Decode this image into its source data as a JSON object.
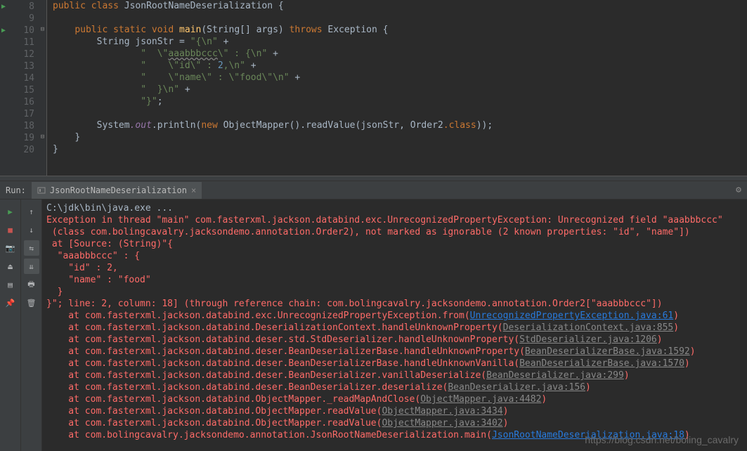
{
  "gutter_lines": [
    "8",
    "9",
    "10",
    "11",
    "12",
    "13",
    "14",
    "15",
    "16",
    "17",
    "18",
    "19",
    "20"
  ],
  "code": {
    "l8": {
      "kw1": "public",
      "kw2": "class",
      "cls": "JsonRootNameDeserialization",
      "brace": "{"
    },
    "l10": {
      "kw1": "public",
      "kw2": "static",
      "kw3": "void",
      "mtd": "main",
      "args": "(String[] args)",
      "kw4": "throws",
      "exc": "Exception",
      "brace": "{"
    },
    "l11": {
      "type": "String",
      "var": "jsonStr",
      "assign": "= ",
      "str": "\"{\\n\"",
      "plus": " +"
    },
    "l12": {
      "str1": "\"  \\\"",
      "wavy": "aaabbbccc",
      "str2": "\\\" : {\\n\"",
      "plus": " +"
    },
    "l13": {
      "str": "\"    \\\"id\\\" : ",
      "num": "2",
      "str2": ",\\n\"",
      "plus": " +"
    },
    "l14": {
      "str": "\"    \\\"name\\\" : \\\"food\\\"\\n\"",
      "plus": " +"
    },
    "l15": {
      "str": "\"  }\\n\"",
      "plus": " +"
    },
    "l16": {
      "str": "\"}\"",
      "semi": ";"
    },
    "l18": {
      "sys": "System",
      "out": ".out",
      "print": ".println(",
      "kw": "new",
      "om": "ObjectMapper",
      "call": "().readValue(jsonStr, Order2",
      "kwc": ".class",
      "rest": "));"
    },
    "l19": {
      "brace": "}"
    },
    "l20": {
      "brace": "}"
    }
  },
  "run_header": {
    "label": "Run:",
    "tab_label": "JsonRootNameDeserialization"
  },
  "console": {
    "l0": "C:\\jdk\\bin\\java.exe ...",
    "l1": "Exception in thread \"main\" com.fasterxml.jackson.databind.exc.UnrecognizedPropertyException: Unrecognized field \"aaabbbccc\"",
    "l1b": " (class com.bolingcavalry.jacksondemo.annotation.Order2), not marked as ignorable (2 known properties: \"id\", \"name\"])",
    "l2": " at [Source: (String)\"{",
    "l3": "  \"aaabbbccc\" : {",
    "l4": "    \"id\" : 2,",
    "l5": "    \"name\" : \"food\"",
    "l6": "  }",
    "l7": "}\"; line: 2, column: 18] (through reference chain: com.bolingcavalry.jacksondemo.annotation.Order2[\"aaabbbccc\"])",
    "st1a": "    at com.fasterxml.jackson.databind.exc.UnrecognizedPropertyException.from(",
    "st1l": "UnrecognizedPropertyException.java:61",
    "st1c": ")",
    "st2a": "    at com.fasterxml.jackson.databind.DeserializationContext.handleUnknownProperty(",
    "st2l": "DeserializationContext.java:855",
    "st2c": ")",
    "st3a": "    at com.fasterxml.jackson.databind.deser.std.StdDeserializer.handleUnknownProperty(",
    "st3l": "StdDeserializer.java:1206",
    "st3c": ")",
    "st4a": "    at com.fasterxml.jackson.databind.deser.BeanDeserializerBase.handleUnknownProperty(",
    "st4l": "BeanDeserializerBase.java:1592",
    "st4c": ")",
    "st5a": "    at com.fasterxml.jackson.databind.deser.BeanDeserializerBase.handleUnknownVanilla(",
    "st5l": "BeanDeserializerBase.java:1570",
    "st5c": ")",
    "st6a": "    at com.fasterxml.jackson.databind.deser.BeanDeserializer.vanillaDeserialize(",
    "st6l": "BeanDeserializer.java:299",
    "st6c": ")",
    "st7a": "    at com.fasterxml.jackson.databind.deser.BeanDeserializer.deserialize(",
    "st7l": "BeanDeserializer.java:156",
    "st7c": ")",
    "st8a": "    at com.fasterxml.jackson.databind.ObjectMapper._readMapAndClose(",
    "st8l": "ObjectMapper.java:4482",
    "st8c": ")",
    "st9a": "    at com.fasterxml.jackson.databind.ObjectMapper.readValue(",
    "st9l": "ObjectMapper.java:3434",
    "st9c": ")",
    "st10a": "    at com.fasterxml.jackson.databind.ObjectMapper.readValue(",
    "st10l": "ObjectMapper.java:3402",
    "st10c": ")",
    "st11a": "    at com.bolingcavalry.jacksondemo.annotation.JsonRootNameDeserialization.main(",
    "st11l": "JsonRootNameDeserialization.java:18",
    "st11c": ")"
  },
  "watermark": "https://blog.csdn.net/boling_cavalry"
}
